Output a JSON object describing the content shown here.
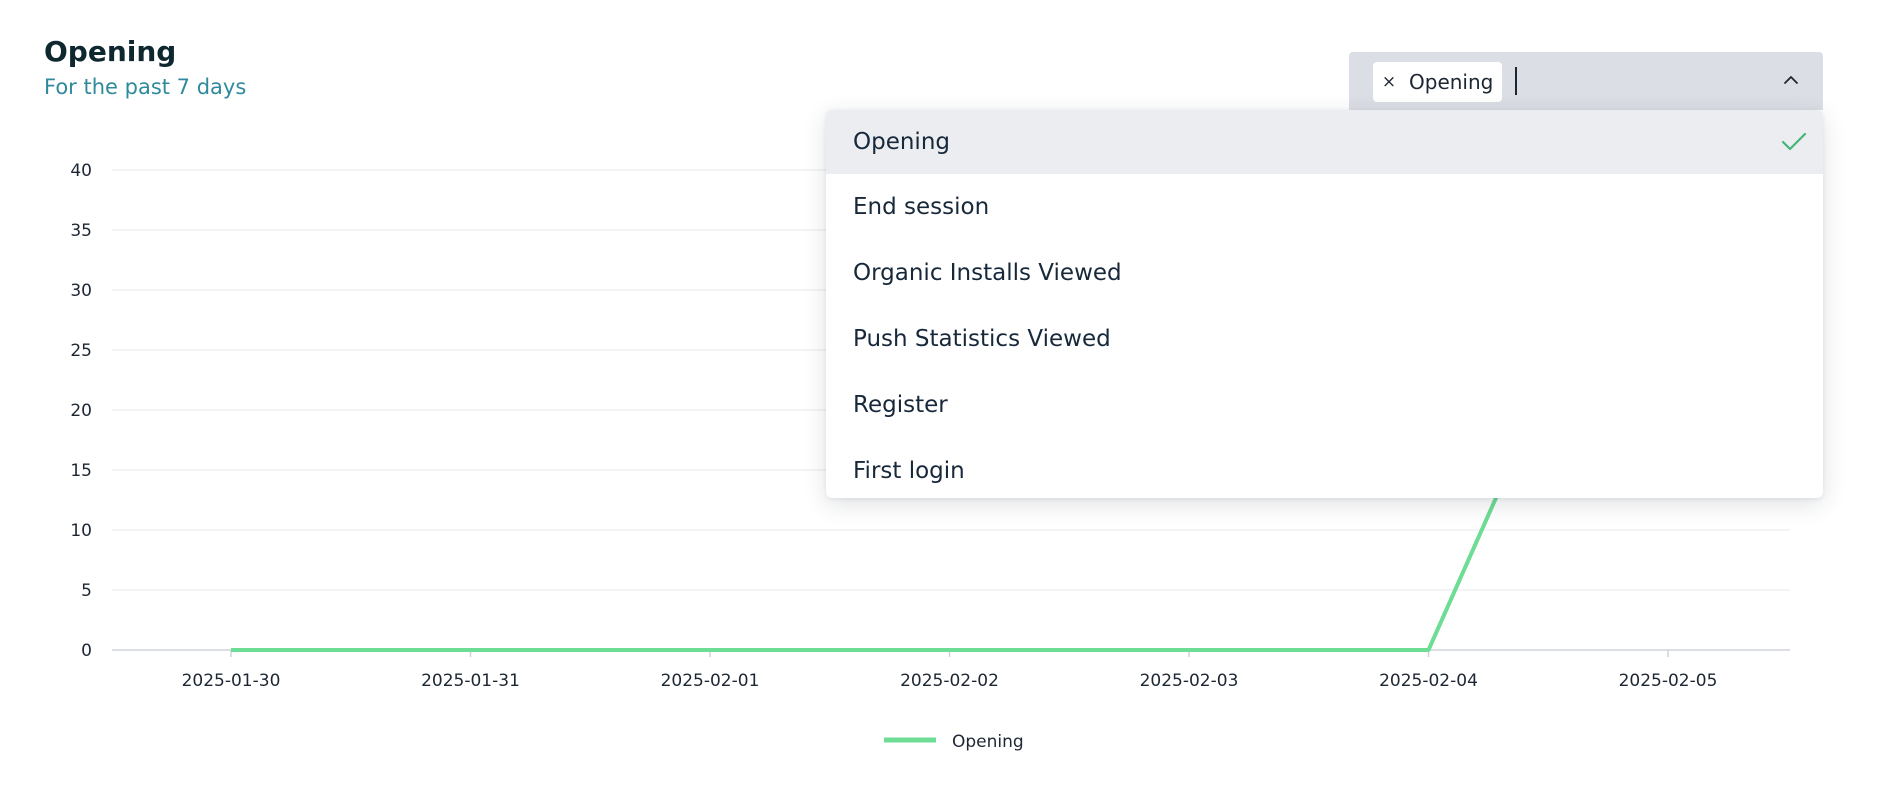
{
  "header": {
    "title": "Opening",
    "subtitle": "For the past 7 days"
  },
  "event_select": {
    "selected_chip": "Opening",
    "remove_glyph": "×",
    "expanded": true,
    "chevron_icon": "chevron-up-icon"
  },
  "dropdown": {
    "options": [
      {
        "label": "Opening",
        "selected": true
      },
      {
        "label": "End session",
        "selected": false
      },
      {
        "label": "Organic Installs Viewed",
        "selected": false
      },
      {
        "label": "Push Statistics Viewed",
        "selected": false
      },
      {
        "label": "Register",
        "selected": false
      },
      {
        "label": "First login",
        "selected": false
      }
    ],
    "check_icon": "checkmark-icon"
  },
  "colors": {
    "series_line": "#6ddc94",
    "checkmark": "#46b478",
    "grid": "#e6e8eb",
    "axis": "#cfd3d8",
    "subtitle": "#2f8a9c"
  },
  "chart_data": {
    "type": "line",
    "title": "Opening",
    "subtitle": "For the past 7 days",
    "xlabel": "",
    "ylabel": "",
    "x": [
      "2025-01-30",
      "2025-01-31",
      "2025-02-01",
      "2025-02-02",
      "2025-02-03",
      "2025-02-04",
      "2025-02-05"
    ],
    "y_ticks": [
      0,
      5,
      10,
      15,
      20,
      25,
      30,
      35,
      40
    ],
    "ylim": [
      0,
      40
    ],
    "grid": true,
    "legend_position": "bottom-center",
    "series": [
      {
        "name": "Opening",
        "values": [
          0,
          0,
          0,
          0,
          0,
          0,
          null
        ]
      }
    ]
  }
}
